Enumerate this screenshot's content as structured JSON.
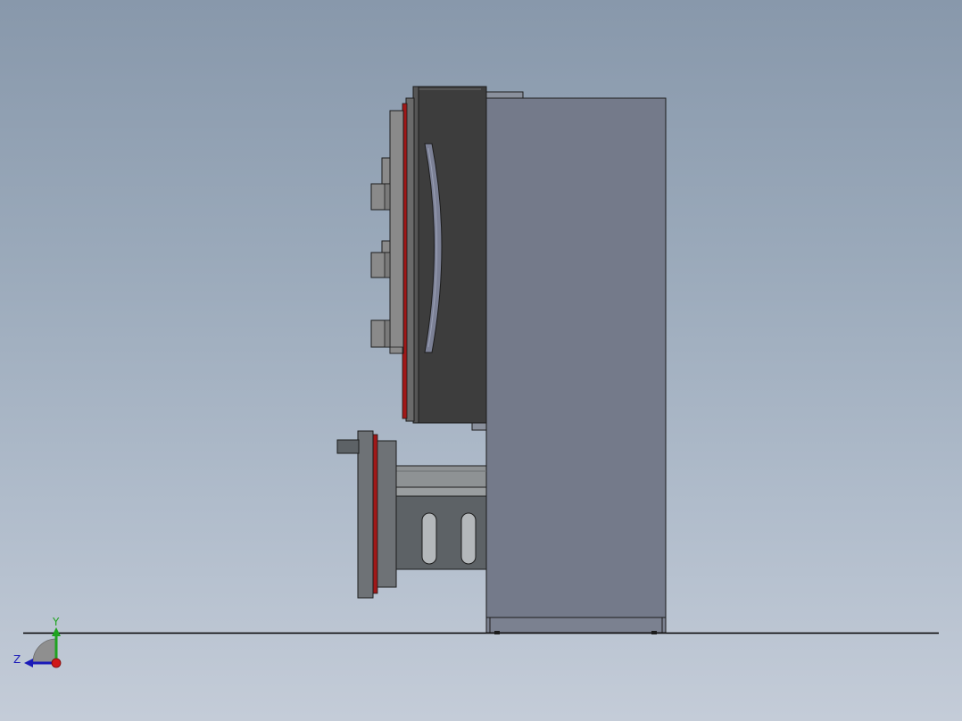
{
  "viewport": {
    "background_top": "#8898ab",
    "background_bottom": "#c4ccd8"
  },
  "triad": {
    "y_label": "Y",
    "z_label": "Z",
    "y_color": "#1fa31f",
    "z_color": "#1a1ab8",
    "x_color": "#d01818"
  },
  "model": {
    "cabinet_color": "#747a8a",
    "door_color": "#3d3d3d",
    "gasket_color": "#a01818",
    "bracket_color": "#5d6266"
  }
}
